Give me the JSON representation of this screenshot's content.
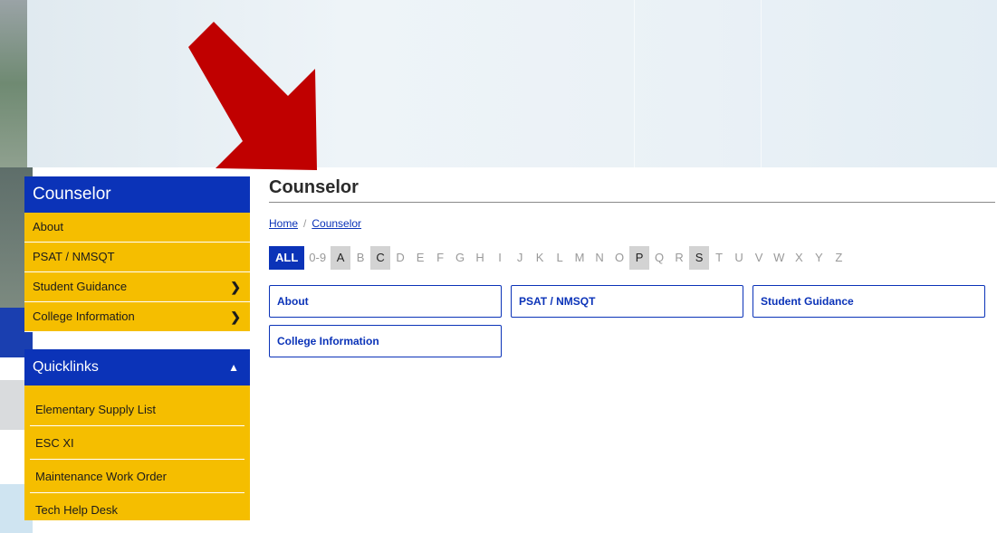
{
  "sidebar": {
    "title": "Counselor",
    "items": [
      {
        "label": "About",
        "has_children": false
      },
      {
        "label": "PSAT / NMSQT",
        "has_children": false
      },
      {
        "label": "Student Guidance",
        "has_children": true
      },
      {
        "label": "College Information",
        "has_children": true
      }
    ]
  },
  "quicklinks": {
    "title": "Quicklinks",
    "expanded": true,
    "items": [
      {
        "label": "Elementary Supply List"
      },
      {
        "label": "ESC XI"
      },
      {
        "label": "Maintenance Work Order"
      },
      {
        "label": "Tech Help Desk"
      }
    ]
  },
  "main": {
    "title": "Counselor",
    "breadcrumb": [
      {
        "label": "Home"
      },
      {
        "label": "Counselor"
      }
    ],
    "alphabet": {
      "all_label": "ALL",
      "letters": [
        {
          "label": "0-9",
          "active": false
        },
        {
          "label": "A",
          "active": true
        },
        {
          "label": "B",
          "active": false
        },
        {
          "label": "C",
          "active": true
        },
        {
          "label": "D",
          "active": false
        },
        {
          "label": "E",
          "active": false
        },
        {
          "label": "F",
          "active": false
        },
        {
          "label": "G",
          "active": false
        },
        {
          "label": "H",
          "active": false
        },
        {
          "label": "I",
          "active": false
        },
        {
          "label": "J",
          "active": false
        },
        {
          "label": "K",
          "active": false
        },
        {
          "label": "L",
          "active": false
        },
        {
          "label": "M",
          "active": false
        },
        {
          "label": "N",
          "active": false
        },
        {
          "label": "O",
          "active": false
        },
        {
          "label": "P",
          "active": true
        },
        {
          "label": "Q",
          "active": false
        },
        {
          "label": "R",
          "active": false
        },
        {
          "label": "S",
          "active": true
        },
        {
          "label": "T",
          "active": false
        },
        {
          "label": "U",
          "active": false
        },
        {
          "label": "V",
          "active": false
        },
        {
          "label": "W",
          "active": false
        },
        {
          "label": "X",
          "active": false
        },
        {
          "label": "Y",
          "active": false
        },
        {
          "label": "Z",
          "active": false
        }
      ]
    },
    "cards": [
      {
        "label": "About"
      },
      {
        "label": "PSAT / NMSQT"
      },
      {
        "label": "Student Guidance"
      },
      {
        "label": "College Information"
      }
    ]
  },
  "colors": {
    "brand_blue": "#0b33b8",
    "brand_gold": "#f5be00",
    "arrow_red": "#c00000"
  },
  "icons": {
    "submenu": "chevron-right-icon",
    "collapse": "chevron-up-icon",
    "pointer": "arrow-down-right-icon"
  }
}
